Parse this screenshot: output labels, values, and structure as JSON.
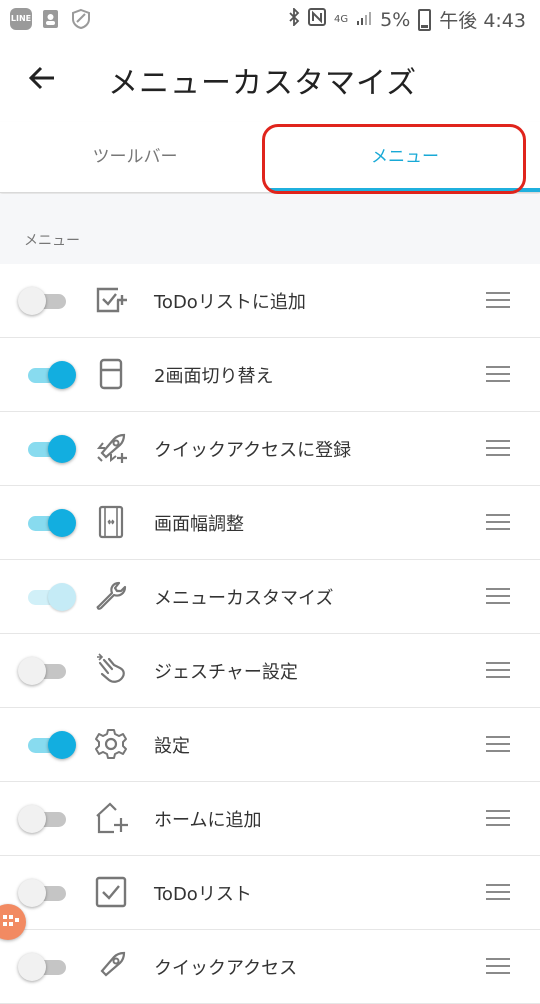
{
  "status_bar": {
    "left_icons": [
      "line-icon",
      "contacts-icon",
      "shield-icon"
    ],
    "line_text": "LINE",
    "network": "4G",
    "battery": "5%",
    "time": "午後 4:43"
  },
  "app_bar": {
    "title": "メニューカスタマイズ"
  },
  "tabs": [
    {
      "label": "ツールバー",
      "selected": false
    },
    {
      "label": "メニュー",
      "selected": true
    }
  ],
  "section": {
    "label": "メニュー"
  },
  "items": [
    {
      "label": "ToDoリストに追加",
      "enabled": false,
      "icon": "checkbox-plus-icon"
    },
    {
      "label": "2画面切り替え",
      "enabled": true,
      "icon": "split-screen-icon"
    },
    {
      "label": "クイックアクセスに登録",
      "enabled": true,
      "icon": "rocket-plus-icon"
    },
    {
      "label": "画面幅調整",
      "enabled": true,
      "icon": "width-adjust-icon"
    },
    {
      "label": "メニューカスタマイズ",
      "enabled": true,
      "icon": "wrench-icon"
    },
    {
      "label": "ジェスチャー設定",
      "enabled": false,
      "icon": "gesture-hand-icon"
    },
    {
      "label": "設定",
      "enabled": true,
      "icon": "gear-icon"
    },
    {
      "label": "ホームに追加",
      "enabled": false,
      "icon": "home-plus-icon"
    },
    {
      "label": "ToDoリスト",
      "enabled": false,
      "icon": "checkbox-icon"
    },
    {
      "label": "クイックアクセス",
      "enabled": false,
      "icon": "rocket-icon"
    }
  ],
  "colors": {
    "accent": "#12aee0",
    "highlight": "#e0241c"
  }
}
